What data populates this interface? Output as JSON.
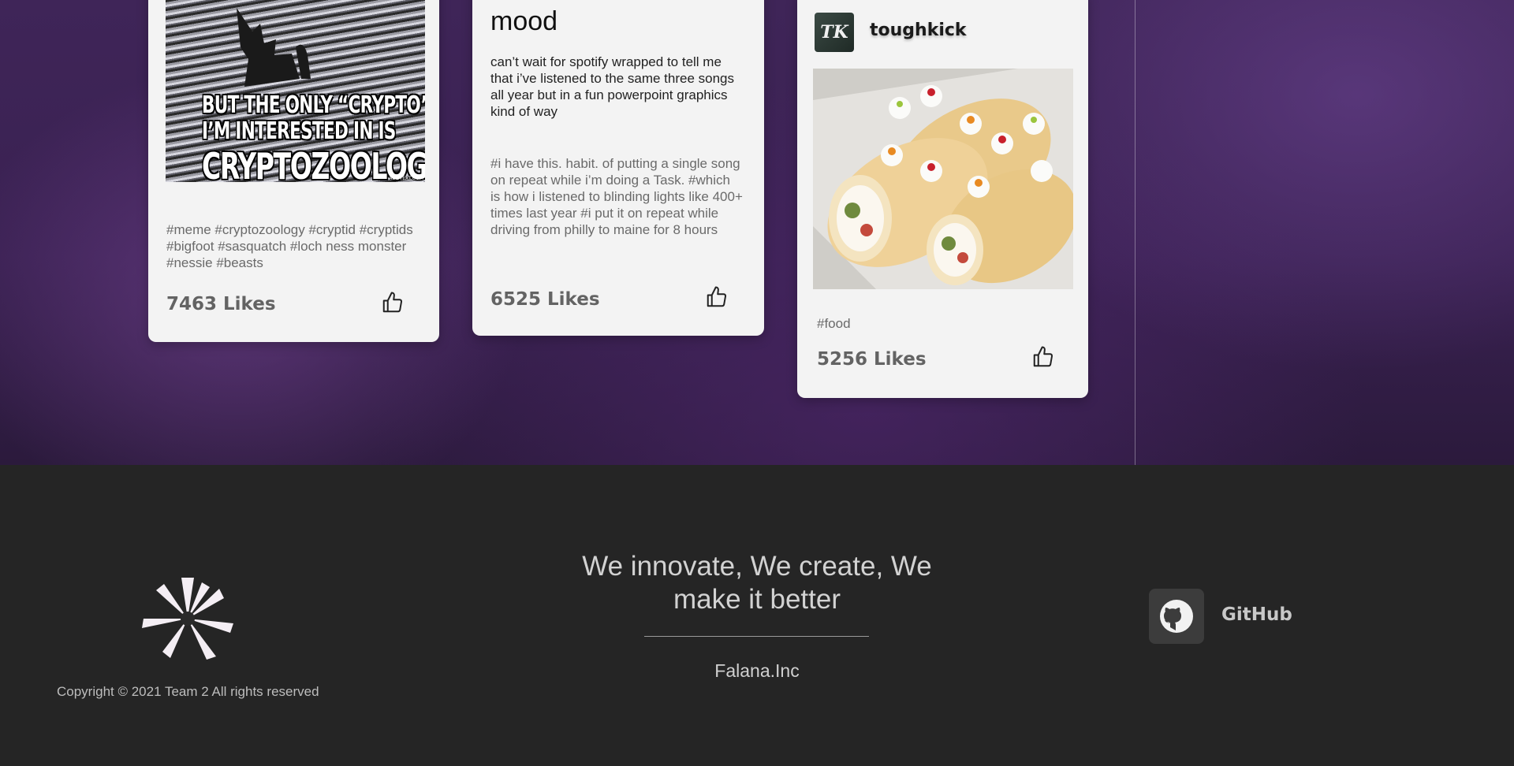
{
  "posts": [
    {
      "image_caption_lines": [
        "BUT THE ONLY “CRYPTO”",
        "I’M INTERESTED IN IS",
        "CRYPTOZOOLOGY"
      ],
      "image_watermark": "ADDTEXT.COM",
      "tags": "#meme #cryptozoology #cryptid #cryptids #bigfoot #sasquatch #loch ness monster #nessie #beasts",
      "likes": "7463 Likes"
    },
    {
      "title": "mood",
      "body": "can’t wait for spotify wrapped to tell me that i’ve listened to the same three songs all year but in a fun powerpoint graphics kind of way",
      "tags": "#i have this. habit. of putting a single song on repeat while i’m doing a Task. #which is how i listened to blinding lights like 400+ times last year #i put it on repeat while driving from philly to maine for 8 hours",
      "likes": "6525 Likes"
    },
    {
      "avatar_text": "TK",
      "username": "toughkick",
      "tags": "#food",
      "likes": "5256 Likes"
    }
  ],
  "footer": {
    "copyright": "Copyright © 2021 Team 2 All rights reserved",
    "tagline": "We innovate, We create, We make it better",
    "company": "Falana.Inc",
    "github_label": "GitHub"
  },
  "colors": {
    "card_bg": "#f3f3f3",
    "footer_bg": "#252525",
    "feed_bg": "#3a2152"
  },
  "icons": [
    "thumbs-up-icon",
    "github-icon",
    "flower-logo"
  ]
}
